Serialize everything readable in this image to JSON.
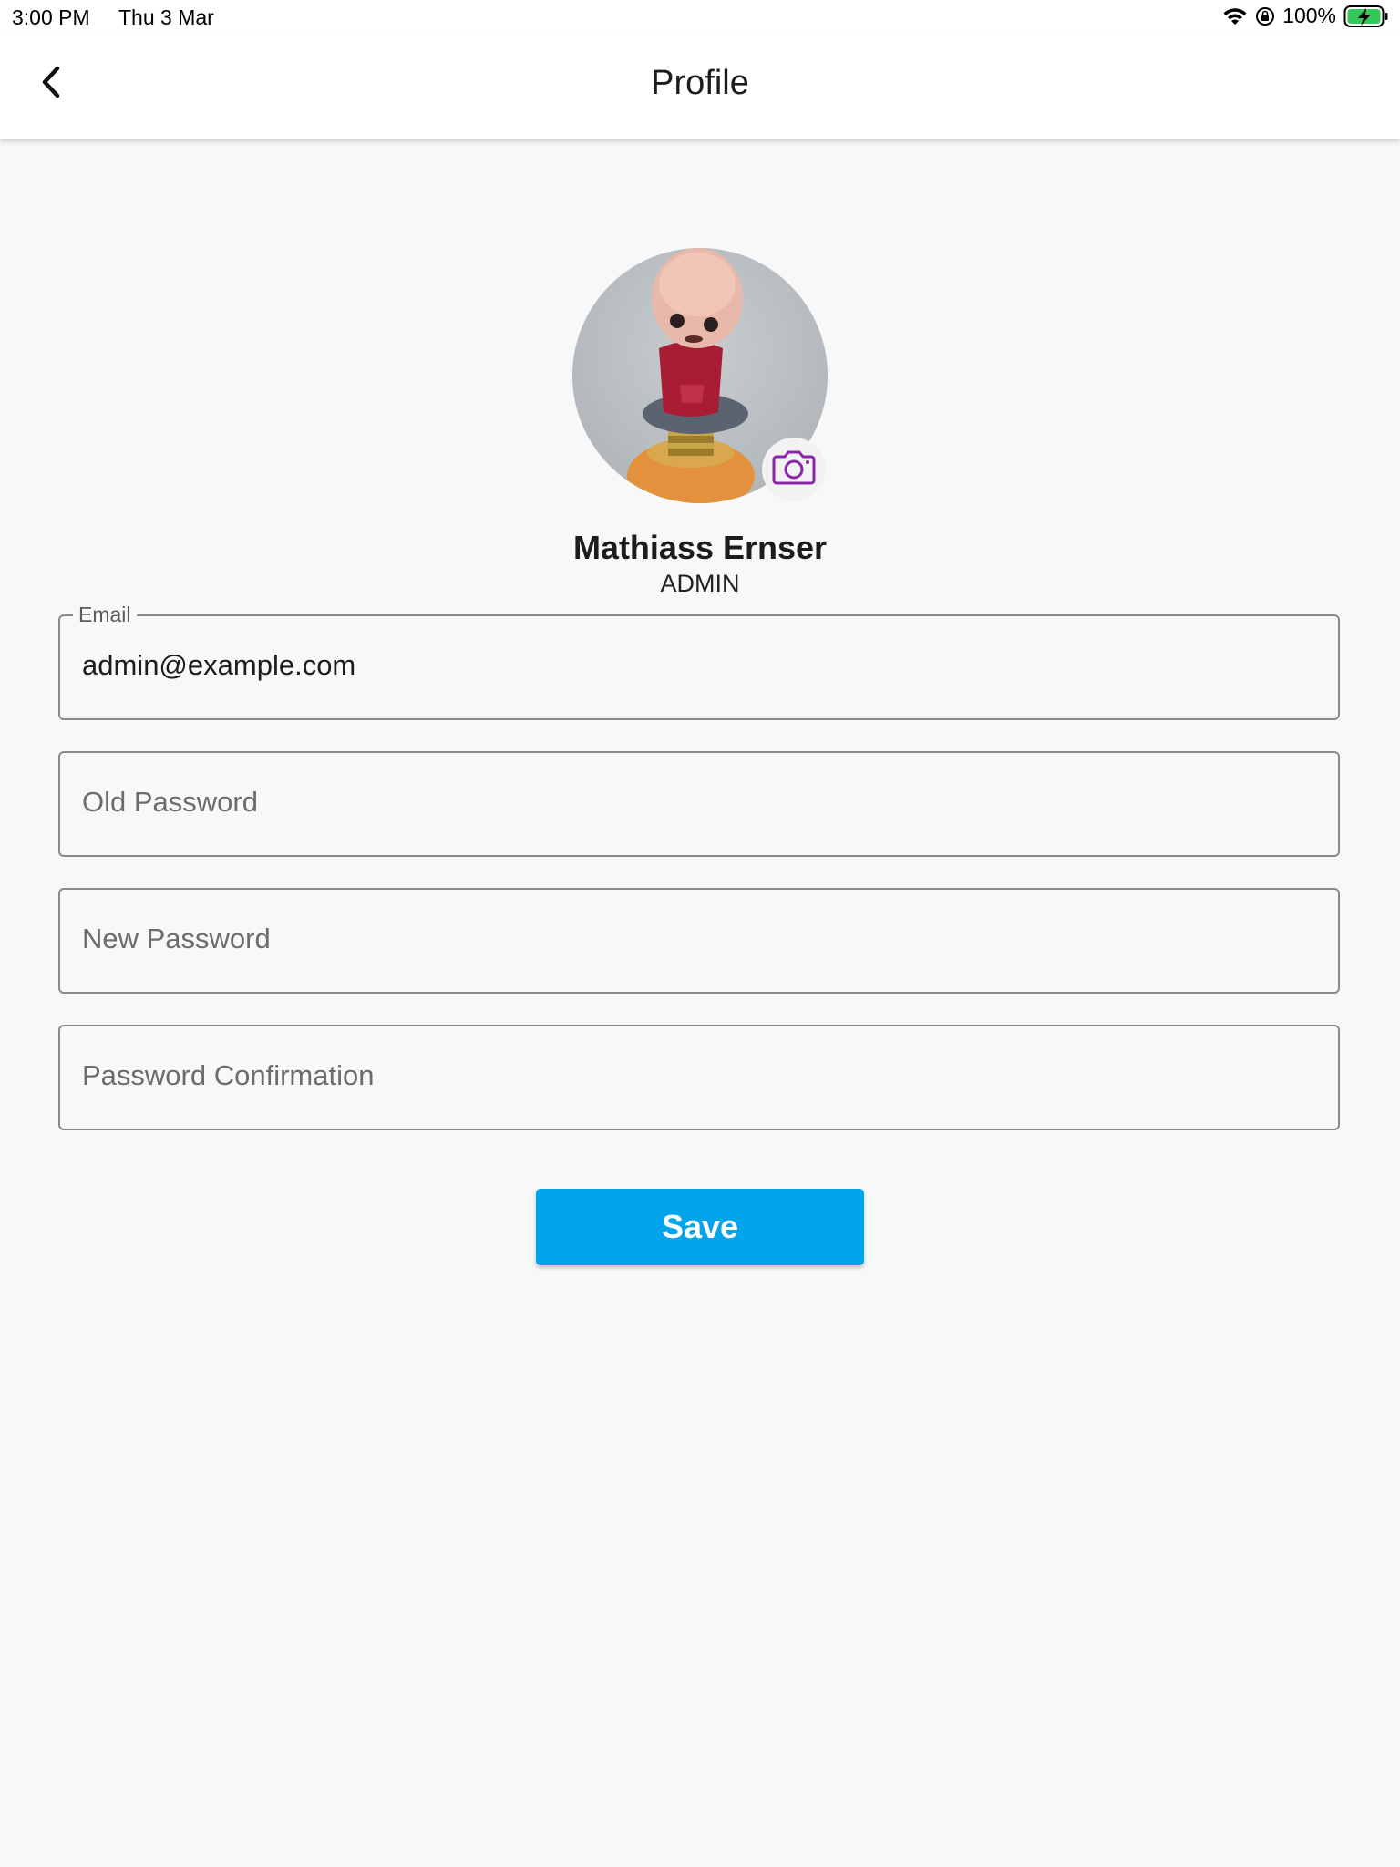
{
  "status_bar": {
    "time": "3:00 PM",
    "date": "Thu 3 Mar",
    "battery": "100%",
    "icons": [
      "wifi-icon",
      "orientation-lock-icon",
      "battery-charging-icon"
    ]
  },
  "app_bar": {
    "title": "Profile",
    "back_icon": "chevron-left-icon"
  },
  "profile": {
    "avatar": "user-avatar-photo",
    "camera_icon": "camera-icon",
    "name": "Mathiass Ernser",
    "role": "ADMIN"
  },
  "form": {
    "email": {
      "label": "Email",
      "value": "admin@example.com"
    },
    "old_password": {
      "placeholder": "Old Password"
    },
    "new_password": {
      "placeholder": "New Password"
    },
    "password_confirmation": {
      "placeholder": "Password Confirmation"
    },
    "save_label": "Save"
  },
  "colors": {
    "primary": "#03a5ea",
    "accent_icon": "#8e24aa",
    "background": "#f8f8f8",
    "battery_green": "#34c759"
  }
}
